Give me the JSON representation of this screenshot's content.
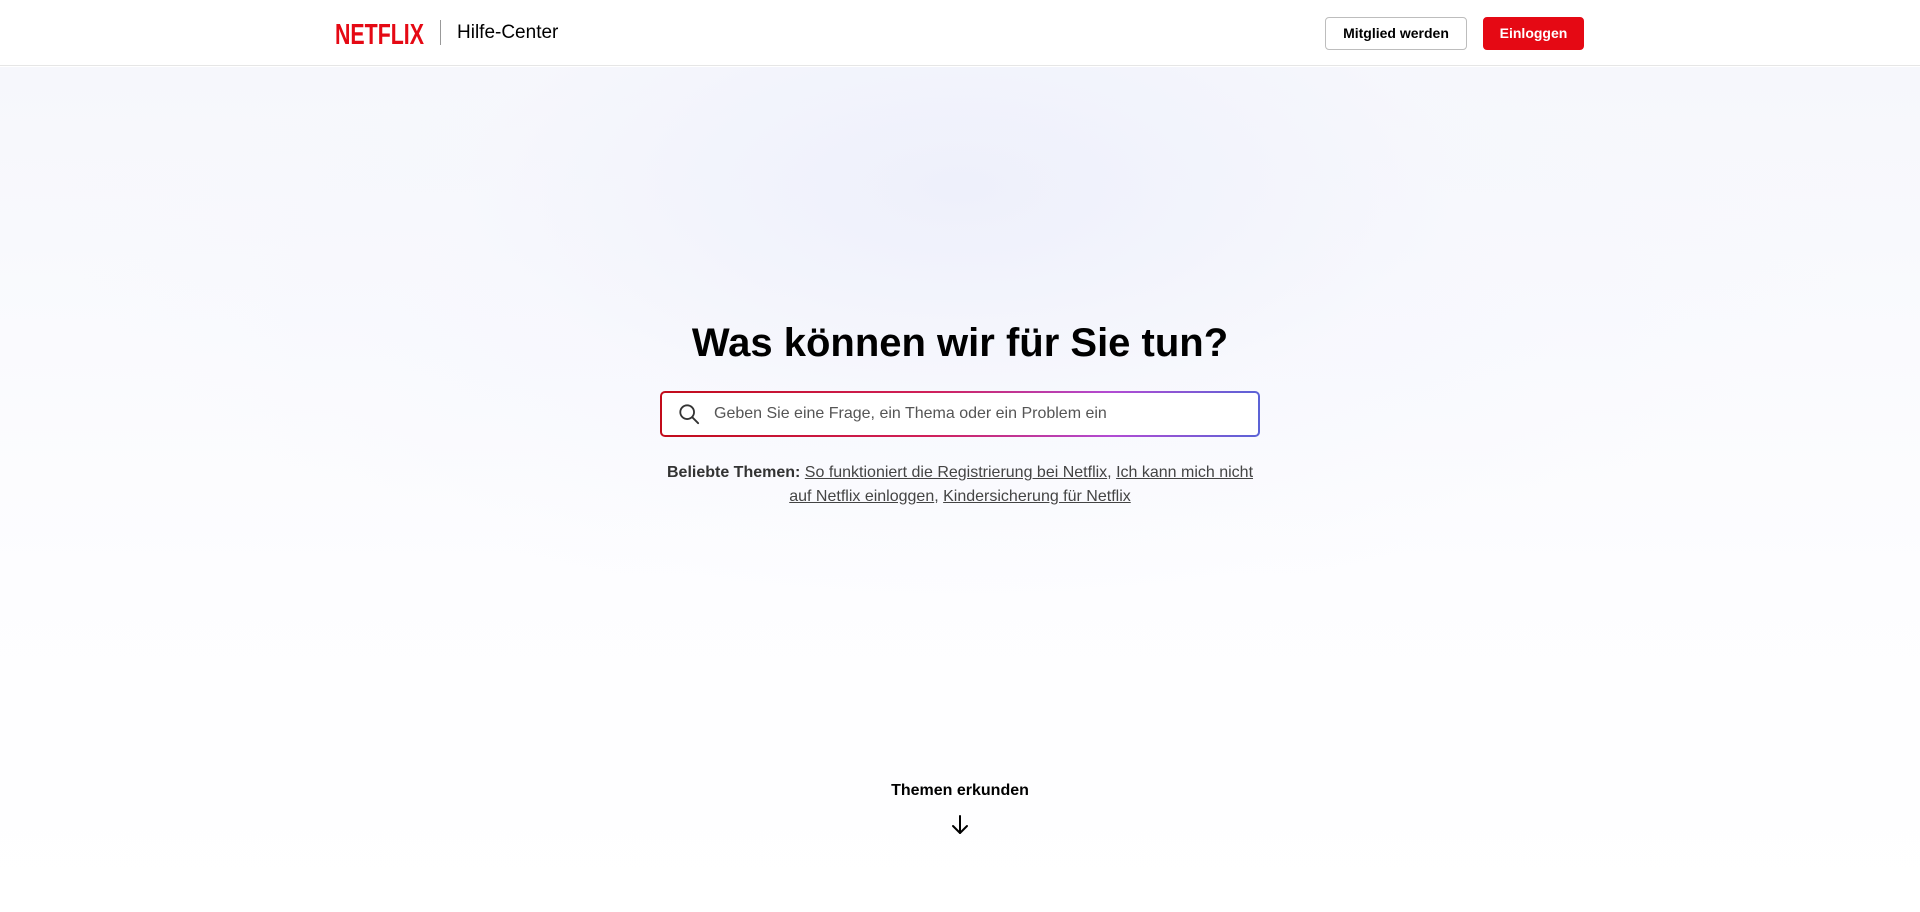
{
  "header": {
    "logo_text": "NETFLIX",
    "title": "Hilfe-Center",
    "signup_label": "Mitglied werden",
    "login_label": "Einloggen"
  },
  "hero": {
    "heading": "Was können wir für Sie tun?",
    "search": {
      "placeholder": "Geben Sie eine Frage, ein Thema oder ein Problem ein",
      "value": ""
    },
    "popular": {
      "label": "Beliebte Themen:",
      "links": [
        "So funktioniert die Registrierung bei Netflix",
        "Ich kann mich nicht auf Netflix einloggen",
        "Kindersicherung für Netflix"
      ],
      "separator": ", "
    }
  },
  "explore": {
    "label": "Themen erkunden",
    "icon": "arrow-down-icon"
  },
  "colors": {
    "brand_red": "#e50914",
    "text": "#000000",
    "muted_text": "#444444"
  }
}
